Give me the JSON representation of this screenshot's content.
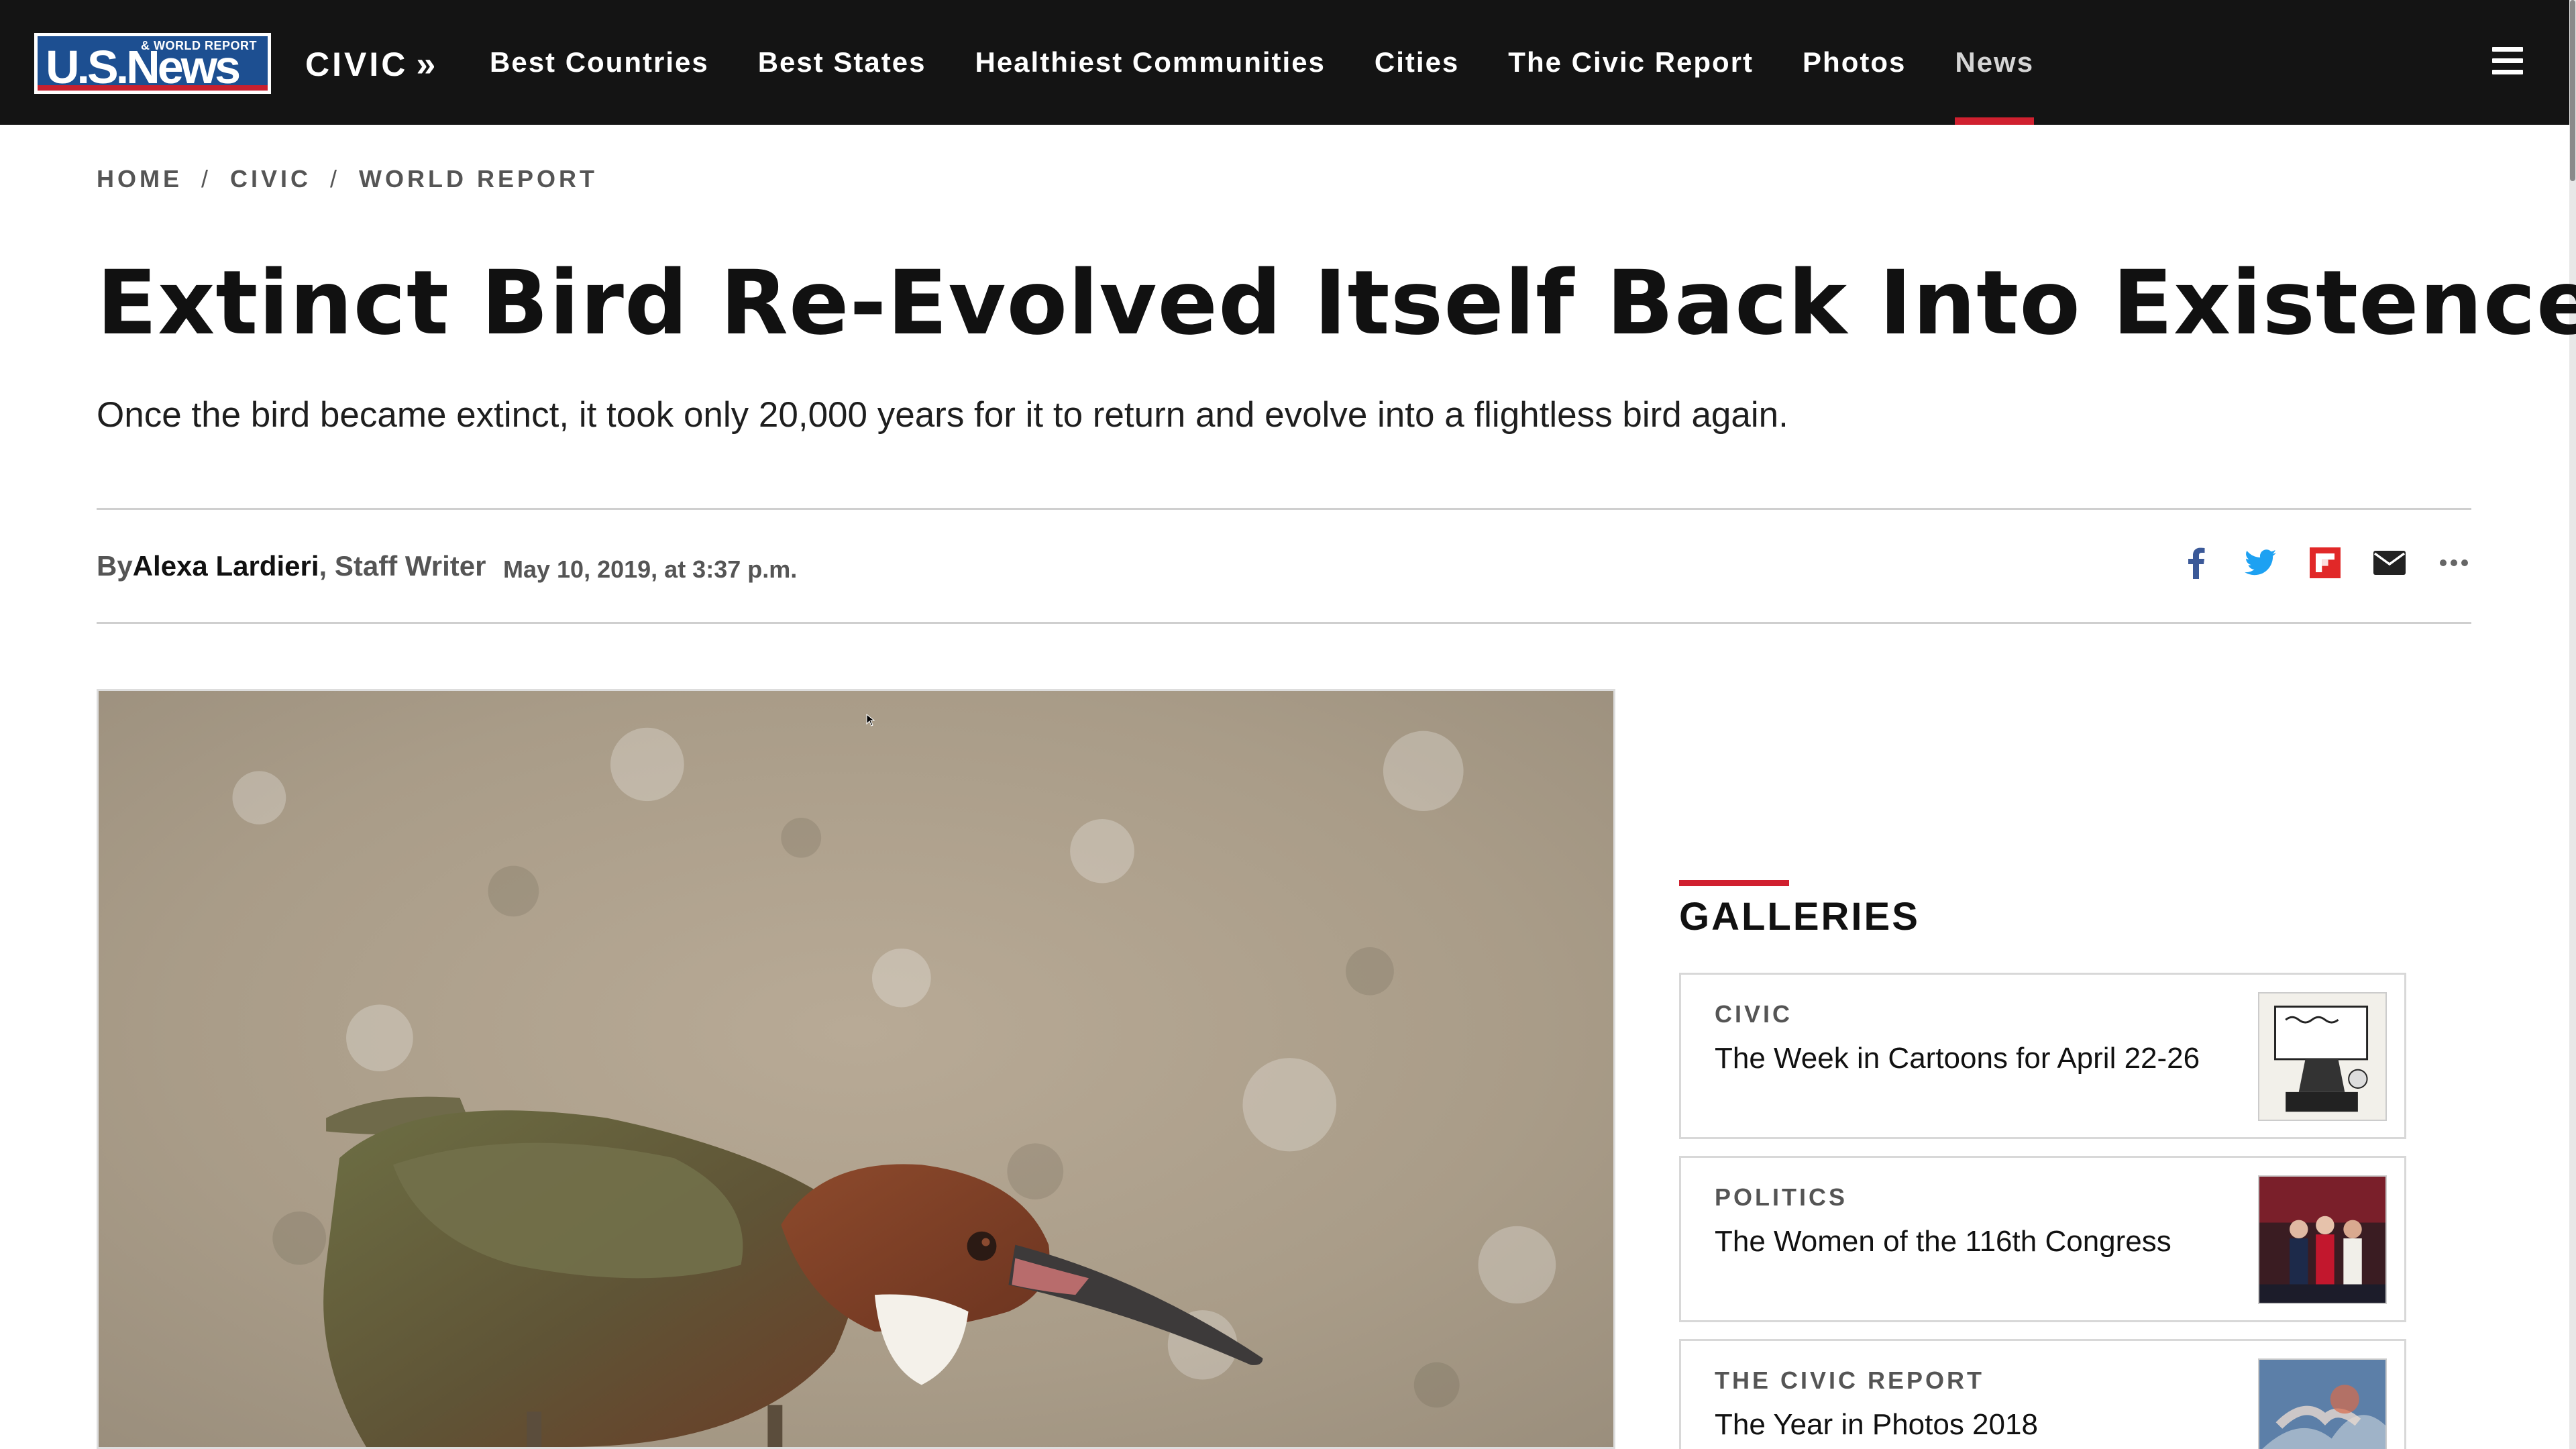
{
  "header": {
    "logo_main": "U.S.News",
    "logo_sub": "& WORLD REPORT",
    "section": "CIVIC",
    "section_chevron": "»",
    "nav": [
      {
        "label": "Best Countries",
        "active": false
      },
      {
        "label": "Best States",
        "active": false
      },
      {
        "label": "Healthiest Communities",
        "active": false
      },
      {
        "label": "Cities",
        "active": false
      },
      {
        "label": "The Civic Report",
        "active": false
      },
      {
        "label": "Photos",
        "active": false
      },
      {
        "label": "News",
        "active": true
      }
    ],
    "menu_icon": "hamburger-icon"
  },
  "breadcrumb": [
    "HOME",
    "CIVIC",
    "WORLD REPORT"
  ],
  "breadcrumb_sep": "/",
  "article": {
    "headline": "Extinct Bird Re-Evolved Itself Back Into Existence",
    "dek": "Once the bird became extinct, it took only 20,000 years for it to return and evolve into a flightless bird again.",
    "by": "By ",
    "author": "Alexa Lardieri",
    "role": ", Staff Writer",
    "timestamp": "May 10, 2019, at 3:37 p.m."
  },
  "share_icons": [
    "facebook-icon",
    "twitter-icon",
    "flipboard-icon",
    "email-icon",
    "more-icon"
  ],
  "colors": {
    "nav_bg": "#141414",
    "accent_red": "#d0202f",
    "logo_blue": "#1d4f91",
    "facebook": "#3b5998",
    "twitter": "#1da1f2",
    "flipboard": "#e12828"
  },
  "sidebar": {
    "title": "GALLERIES",
    "cards": [
      {
        "category": "CIVIC",
        "title": "The Week in Cartoons for April 22-26"
      },
      {
        "category": "POLITICS",
        "title": "The Women of the 116th Congress"
      },
      {
        "category": "THE CIVIC REPORT",
        "title": "The Year in Photos 2018"
      }
    ]
  }
}
